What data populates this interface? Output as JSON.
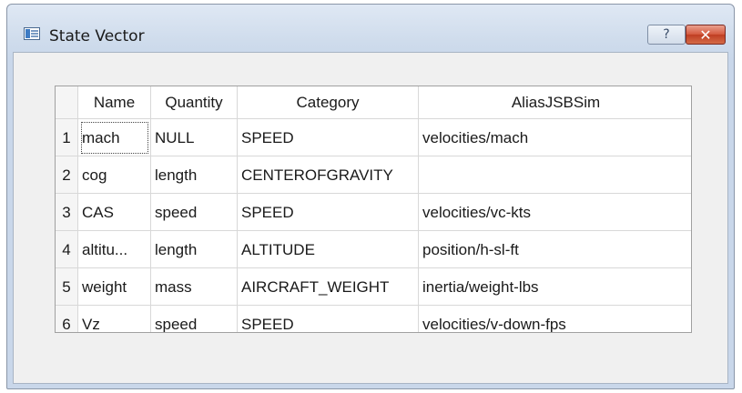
{
  "window": {
    "title": "State Vector",
    "help_label": "?",
    "close_label": "✕"
  },
  "table": {
    "headers": [
      "Name",
      "Quantity",
      "Category",
      "AliasJSBSim"
    ],
    "rows": [
      {
        "num": "1",
        "name": "mach",
        "quantity": "NULL",
        "category": "SPEED",
        "alias": "velocities/mach"
      },
      {
        "num": "2",
        "name": "cog",
        "quantity": "length",
        "category": "CENTEROFGRAVITY",
        "alias": ""
      },
      {
        "num": "3",
        "name": "CAS",
        "quantity": "speed",
        "category": "SPEED",
        "alias": "velocities/vc-kts"
      },
      {
        "num": "4",
        "name": "altitu...",
        "quantity": "length",
        "category": "ALTITUDE",
        "alias": "position/h-sl-ft"
      },
      {
        "num": "5",
        "name": "weight",
        "quantity": "mass",
        "category": "AIRCRAFT_WEIGHT",
        "alias": "inertia/weight-lbs"
      },
      {
        "num": "6",
        "name": "Vz",
        "quantity": "speed",
        "category": "SPEED",
        "alias": "velocities/v-down-fps"
      }
    ]
  }
}
